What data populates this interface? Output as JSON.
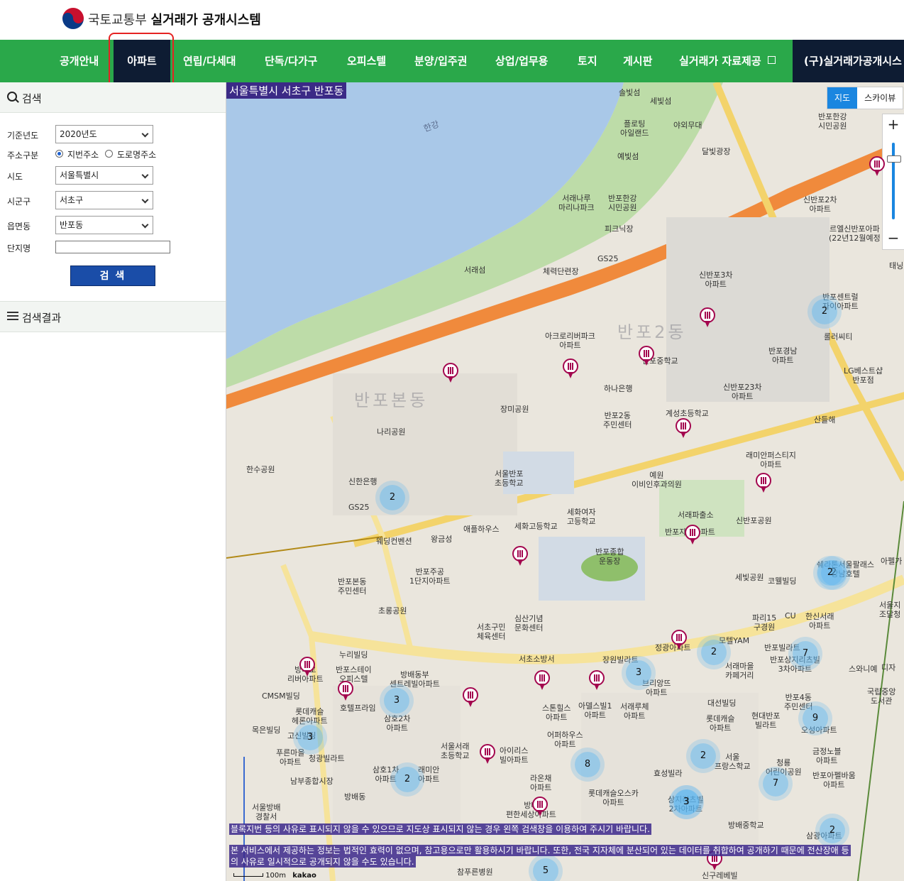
{
  "header": {
    "org": "국토교통부",
    "system": "실거래가 공개시스템"
  },
  "nav": [
    {
      "label": "공개안내"
    },
    {
      "label": "아파트"
    },
    {
      "label": "연립/다세대"
    },
    {
      "label": "단독/다가구"
    },
    {
      "label": "오피스텔"
    },
    {
      "label": "분양/입주권"
    },
    {
      "label": "상업/업무용"
    },
    {
      "label": "토지"
    },
    {
      "label": "게시판"
    },
    {
      "label": "실거래가 자료제공"
    },
    {
      "label": "(구)실거래가공개시스"
    }
  ],
  "sidebar": {
    "search_title": "검색",
    "fields": {
      "year_label": "기준년도",
      "year_value": "2020년도",
      "addr_type_label": "주소구분",
      "addr_opt1": "지번주소",
      "addr_opt2": "도로명주소",
      "sido_label": "시도",
      "sido_value": "서울특별시",
      "sigungu_label": "시군구",
      "sigungu_value": "서초구",
      "eup_label": "읍면동",
      "eup_value": "반포동",
      "complex_label": "단지명",
      "complex_value": ""
    },
    "search_button": "검 색",
    "results_title": "검색결과"
  },
  "map": {
    "region_title": "서울특별시 서초구 반포동",
    "tab_map": "지도",
    "tab_sky": "스카이뷰",
    "zoom_in": "+",
    "zoom_out": "−",
    "notice1": "블록지번 등의 사유로 표시되지 않을 수 있으므로 지도상 표시되지 않는 경우 왼쪽 검색창을 이용하여 주시기 바랍니다.",
    "notice2": "본 서비스에서 제공하는 정보는 법적인 효력이 없으며, 참고용으로만 활용하시기 바랍니다. 또한, 전국 지자체에 분산되어 있는 데이터를 취합하여 공개하기 때문에 전산장애 등",
    "notice3": "의 사유로 일시적으로 공개되지 않을 수도 있습니다.",
    "scale": "100m",
    "provider": "kakao",
    "labels": [
      {
        "t": "한강"
      },
      {
        "t": "솔빛섬"
      },
      {
        "t": "세빛섬"
      },
      {
        "t": "플로팅\n아일랜드"
      },
      {
        "t": "예빛섬"
      },
      {
        "t": "야외무대"
      },
      {
        "t": "달빛광장"
      },
      {
        "t": "반포한강\n시민공원"
      },
      {
        "t": "서래나루\n마리나파크"
      },
      {
        "t": "피크닉장"
      },
      {
        "t": "서래섬"
      },
      {
        "t": "체력단련장"
      },
      {
        "t": "GS25"
      },
      {
        "t": "신반포3차\n아파트"
      },
      {
        "t": "신반포2차\n아파트"
      },
      {
        "t": "르엘신반포아파\n(22년12월예정"
      },
      {
        "t": "반포센트럴\n자이아파트"
      },
      {
        "t": "롤러씨티"
      },
      {
        "t": "반포경남\n아파트"
      },
      {
        "t": "LG베스트샵\n반포점"
      },
      {
        "t": "신반포23차\n아파트"
      },
      {
        "t": "산들해"
      },
      {
        "t": "아크로리버파크\n아파트"
      },
      {
        "t": "반포2동"
      },
      {
        "t": "반포중학교"
      },
      {
        "t": "하나은행"
      },
      {
        "t": "반포2동\n주민센터"
      },
      {
        "t": "계성초등학교"
      },
      {
        "t": "반포본동"
      },
      {
        "t": "장미공원"
      },
      {
        "t": "나리공원"
      },
      {
        "t": "한수공원"
      },
      {
        "t": "신한은행"
      },
      {
        "t": "GS25"
      },
      {
        "t": "래미안퍼스티지\n아파트"
      },
      {
        "t": "예원\n이비인후과의원"
      },
      {
        "t": "서울반포\n초등학교"
      },
      {
        "t": "세화여자\n고등학교"
      },
      {
        "t": "세화고등학교"
      },
      {
        "t": "애플하우스"
      },
      {
        "t": "왕금성"
      },
      {
        "t": "웨딩컨벤션"
      },
      {
        "t": "반포본동\n주민센터"
      },
      {
        "t": "반포주공\n1단지아파트"
      },
      {
        "t": "반포종합\n운동장"
      },
      {
        "t": "서래파출소"
      },
      {
        "t": "신반포공원"
      },
      {
        "t": "반포자이아파트"
      },
      {
        "t": "쉐라톤서울팔래스\n강남호텔"
      },
      {
        "t": "초롱공원"
      },
      {
        "t": "서초구민\n체육센터"
      },
      {
        "t": "심산기념\n문화센터"
      },
      {
        "t": "서초소방서"
      },
      {
        "t": "누리빌딩"
      },
      {
        "t": "방배로\n리버아파트"
      },
      {
        "t": "반포스테이\n오피스텔"
      },
      {
        "t": "방배동부\n센트레빌아파트"
      },
      {
        "t": "CMSM빌딩"
      },
      {
        "t": "호텔프라임"
      },
      {
        "t": "롯데캐슬\n헤론아파트"
      },
      {
        "t": "삼호2차\n아파트"
      },
      {
        "t": "목은빌딩"
      },
      {
        "t": "고신빌딩"
      },
      {
        "t": "푸른마을\n아파트"
      },
      {
        "t": "청광빌라트"
      },
      {
        "t": "서울서래\n초등학교"
      },
      {
        "t": "아이리스\n빌아파트"
      },
      {
        "t": "남부종합시장"
      },
      {
        "t": "삼호1차\n아파트"
      },
      {
        "t": "래미안\n아파트"
      },
      {
        "t": "서울방배\n경찰서"
      },
      {
        "t": "방배동"
      },
      {
        "t": "라온채\n아파트"
      },
      {
        "t": "롯데캐슬오스카\n아파트"
      },
      {
        "t": "방배\n편한세상아파트"
      },
      {
        "t": "어퍼하우스\n아파트"
      },
      {
        "t": "스톤힐스\n아파트"
      },
      {
        "t": "아델스빌1\n아파트"
      },
      {
        "t": "서래루체\n아파트"
      },
      {
        "t": "장원빌라트"
      },
      {
        "t": "브리앙뜨\n아파트"
      },
      {
        "t": "정광아파트"
      },
      {
        "t": "모텔YAM"
      },
      {
        "t": "서래마을\n카페거리"
      },
      {
        "t": "대선빌딩"
      },
      {
        "t": "롯데캐슬\n아파트"
      },
      {
        "t": "현대반포\n빌라트"
      },
      {
        "t": "반포4동\n주민센터"
      },
      {
        "t": "오성아파트"
      },
      {
        "t": "서울\n프랑스학교"
      },
      {
        "t": "효성빌라"
      },
      {
        "t": "상지리츠빌\n2차아파트"
      },
      {
        "t": "금정노블\n아파트"
      },
      {
        "t": "청룡\n어린이공원"
      },
      {
        "t": "반포아펠바움\n아파트"
      },
      {
        "t": "코웰빌딩"
      },
      {
        "t": "파리15\n구경원"
      },
      {
        "t": "CU"
      },
      {
        "t": "한신서래\n아파트"
      },
      {
        "t": "반포빌라트"
      },
      {
        "t": "반포상지리츠빌\n3차아파트"
      },
      {
        "t": "스와니예"
      },
      {
        "t": "디자"
      },
      {
        "t": "국립중앙\n도서관"
      },
      {
        "t": "세빛공원"
      },
      {
        "t": "방배중학교"
      },
      {
        "t": "삼광아파트"
      },
      {
        "t": "참푸른병원"
      },
      {
        "t": "신구레베빌"
      },
      {
        "t": "서울지\n조달청"
      },
      {
        "t": "아펠가"
      },
      {
        "t": "반포한강\n시민공원"
      },
      {
        "t": "태닝"
      }
    ],
    "clusters": [
      "2",
      "2",
      "2",
      "3",
      "3",
      "2",
      "3",
      "3",
      "2",
      "8",
      "2",
      "3",
      "7",
      "7",
      "9",
      "2",
      "2",
      "5"
    ]
  }
}
